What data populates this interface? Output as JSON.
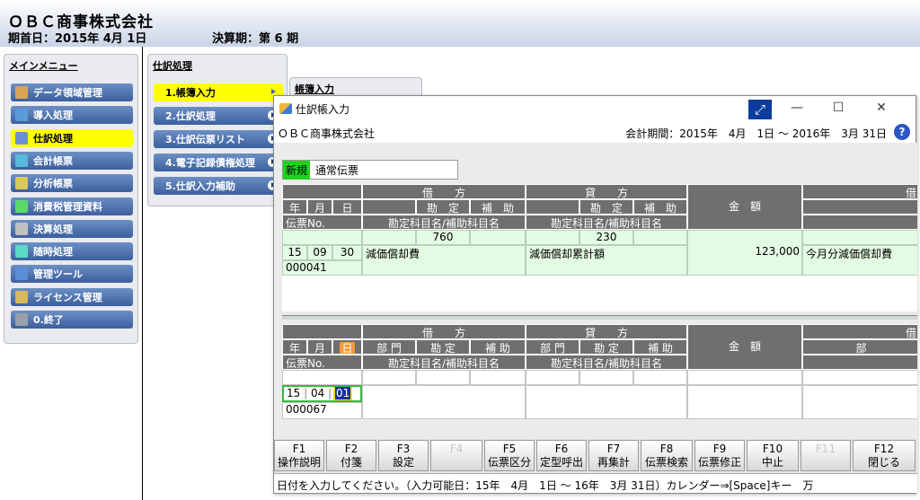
{
  "header": {
    "company": "ＯＢＣ商事株式会社",
    "period_start": "期首日：2015年 4月 1日",
    "fiscal_term": "決算期：第 6 期"
  },
  "main_menu": {
    "title": "メインメニュー",
    "items": [
      {
        "label": "データ領域管理",
        "icon": "database-icon",
        "color": "#d9a35a",
        "selected": false
      },
      {
        "label": "導入処理",
        "icon": "setup-icon",
        "color": "#5a9bd9",
        "selected": false
      },
      {
        "label": "仕訳処理",
        "icon": "journal-icon",
        "color": "#6b8fd6",
        "selected": true
      },
      {
        "label": "会計帳票",
        "icon": "ledger-icon",
        "color": "#5ab8d9",
        "selected": false
      },
      {
        "label": "分析帳票",
        "icon": "analysis-icon",
        "color": "#d9c95a",
        "selected": false
      },
      {
        "label": "消費税管理資料",
        "icon": "tax-icon",
        "color": "#5ad96b",
        "selected": false
      },
      {
        "label": "決算処理",
        "icon": "closing-icon",
        "color": "#c0c0c0",
        "selected": false
      },
      {
        "label": "随時処理",
        "icon": "clock-icon",
        "color": "#5ad9c5",
        "selected": false
      },
      {
        "label": "管理ツール",
        "icon": "tools-icon",
        "color": "#5a8fd9",
        "selected": false
      },
      {
        "label": "ライセンス管理",
        "icon": "license-icon",
        "color": "#d9b85a",
        "selected": false
      },
      {
        "label": "0.終了",
        "icon": "exit-icon",
        "color": "#9aa0aa",
        "selected": false
      }
    ]
  },
  "sub_menu": {
    "title": "仕訳処理",
    "items": [
      {
        "label": "1.帳簿入力",
        "selected": true
      },
      {
        "label": "2.仕訳処理",
        "selected": false
      },
      {
        "label": "3.仕訳伝票リスト",
        "selected": false
      },
      {
        "label": "4.電子記録債権処理",
        "selected": false
      },
      {
        "label": "5.仕訳入力補助",
        "selected": false
      }
    ]
  },
  "sub_menu2": {
    "title": "帳簿入力"
  },
  "window": {
    "title": "仕訳帳入力",
    "company": "ＯＢＣ商事株式会社",
    "period": "会計期間：2015年　4月　1日 ～ 2016年　3月 31日",
    "help": "?",
    "minimize": "—",
    "maximize": "☐",
    "close": "✕",
    "expand": "⤢"
  },
  "entry": {
    "mode": "新規",
    "voucher_type": "通常伝票"
  },
  "top_grid": {
    "h_debit": "借　　方",
    "h_credit": "貸　　方",
    "h_amount": "金　額",
    "h_right": "借",
    "ymd": [
      "年",
      "月",
      "日"
    ],
    "account": "勘　定",
    "sub": "補　助",
    "voucher_no": "伝票No.",
    "account_name": "勘定科目名/補助科目名",
    "rows": [
      {
        "debit_code": "760",
        "credit_code": "230",
        "year": "15",
        "month": "09",
        "day": "30",
        "debit_name": "減価償却費",
        "credit_name": "減価償却累計額",
        "amount": "123,000",
        "memo": "今月分減価償却費",
        "voucher": "000041"
      }
    ]
  },
  "bottom_grid": {
    "h_debit": "借　　方",
    "h_credit": "貸　　方",
    "h_amount": "金　額",
    "h_right": "借",
    "h_right2": "部",
    "ymd": [
      "年",
      "月",
      "日"
    ],
    "dept": "部 門",
    "account": "勘 定",
    "sub": "補 助",
    "voucher_no": "伝票No.",
    "account_name": "勘定科目名/補助科目名",
    "year": "15",
    "month": "04",
    "day": "01",
    "voucher": "000067"
  },
  "function_keys": [
    {
      "key": "F1",
      "label": "操作説明",
      "enabled": true
    },
    {
      "key": "F2",
      "label": "付箋",
      "enabled": true
    },
    {
      "key": "F3",
      "label": "設定",
      "enabled": true
    },
    {
      "key": "F4",
      "label": "",
      "enabled": false
    },
    {
      "key": "F5",
      "label": "伝票区分",
      "enabled": true
    },
    {
      "key": "F6",
      "label": "定型呼出",
      "enabled": true
    },
    {
      "key": "F7",
      "label": "再集計",
      "enabled": true
    },
    {
      "key": "F8",
      "label": "伝票検索",
      "enabled": true
    },
    {
      "key": "F9",
      "label": "伝票修正",
      "enabled": true
    },
    {
      "key": "F10",
      "label": "中止",
      "enabled": true
    },
    {
      "key": "F11",
      "label": "",
      "enabled": false
    },
    {
      "key": "F12",
      "label": "閉じる",
      "enabled": true
    }
  ],
  "status_bar": "日付を入力してください。（入力可能日：15年　4月　1日 ～ 16年　3月 31日）カレンダー⇒[Space]キー　万"
}
